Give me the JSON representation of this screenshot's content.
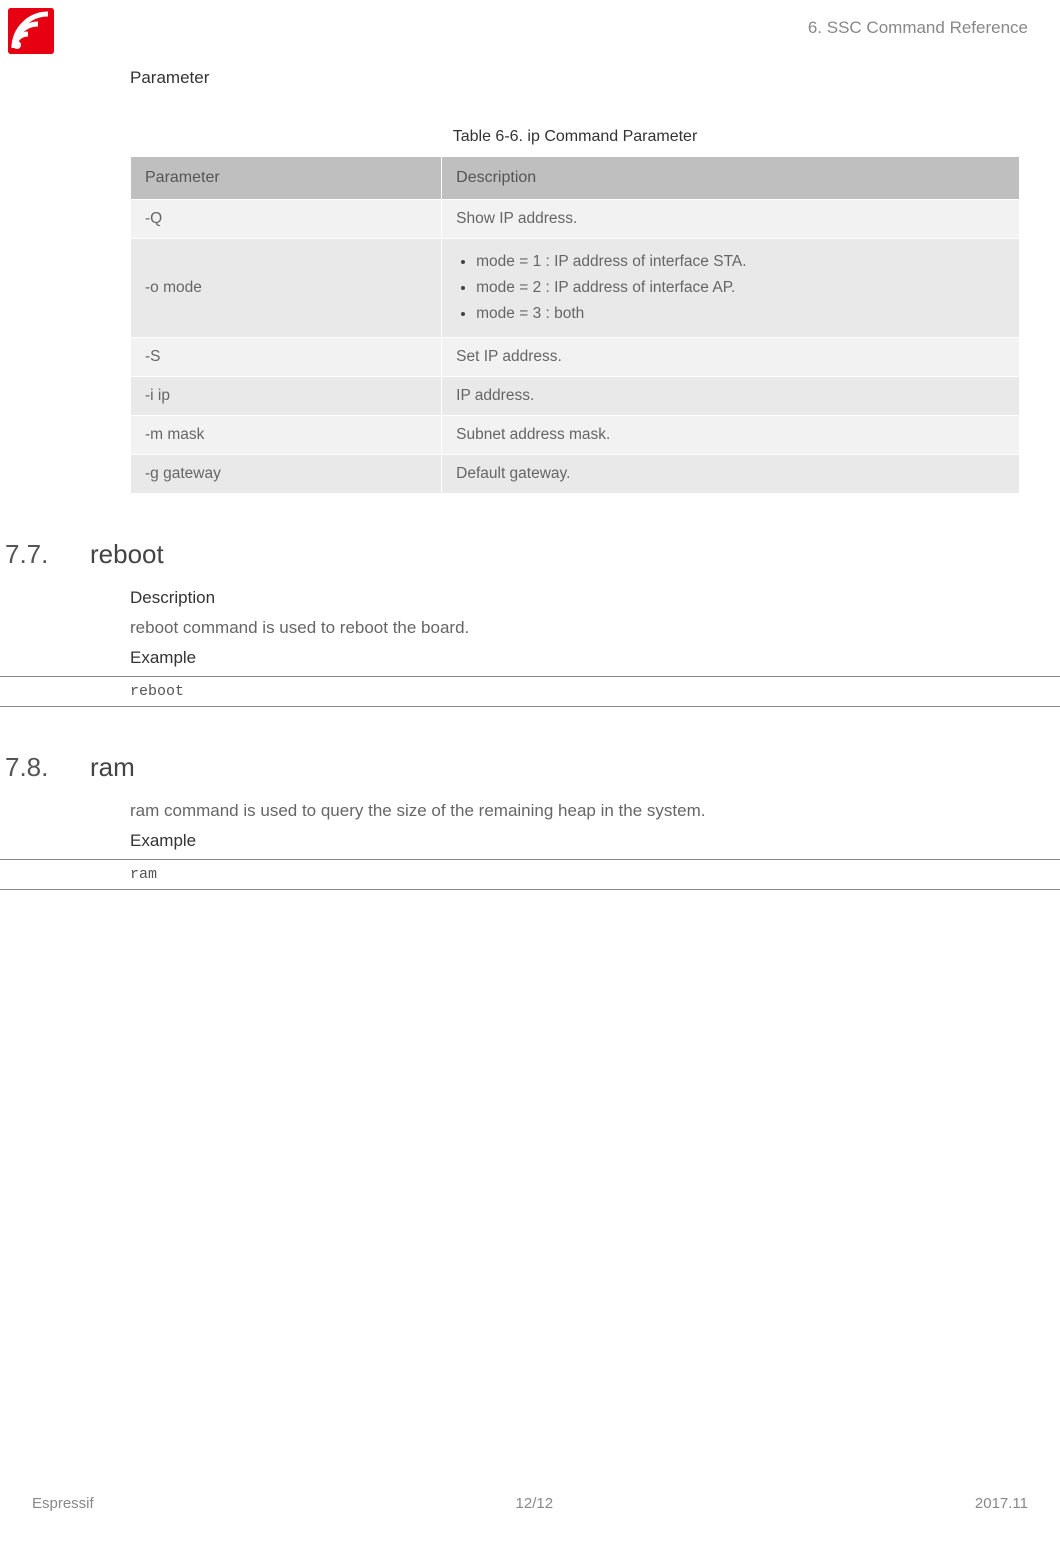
{
  "header": {
    "chapter": "6. SSC Command Reference"
  },
  "sections": {
    "parameter_heading": "Parameter",
    "table_caption": "Table 6-6. ip Command Parameter",
    "table": {
      "col_parameter": "Parameter",
      "col_description": "Description",
      "rows": [
        {
          "param": "-Q",
          "desc": "Show IP address."
        },
        {
          "param": "-o mode",
          "desc_list": [
            "mode = 1 : IP address of interface STA.",
            "mode = 2 : IP address of interface AP.",
            "mode = 3 : both"
          ]
        },
        {
          "param": "-S",
          "desc": "Set IP address."
        },
        {
          "param": "-i ip",
          "desc": "IP address."
        },
        {
          "param": "-m mask",
          "desc": "Subnet address mask."
        },
        {
          "param": "-g gateway",
          "desc": "Default gateway."
        }
      ]
    },
    "s77": {
      "num": "7.7.",
      "title": "reboot",
      "desc_label": "Description",
      "desc_text": "reboot command is used to reboot the board.",
      "example_label": "Example",
      "example_code": "reboot"
    },
    "s78": {
      "num": "7.8.",
      "title": "ram",
      "desc_text": "ram command is used to query the size of the remaining heap in the system.",
      "example_label": "Example",
      "example_code": "ram"
    }
  },
  "footer": {
    "left": "Espressif",
    "center": "12/12",
    "right": "2017.11"
  }
}
